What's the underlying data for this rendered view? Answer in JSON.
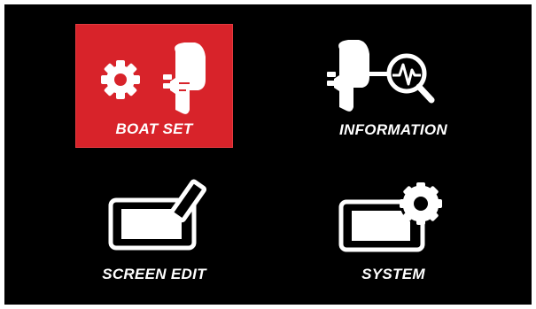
{
  "menu": {
    "items": [
      {
        "label": "BOAT SET",
        "icon": "gear-outboard-motor-icon",
        "selected": true
      },
      {
        "label": "INFORMATION",
        "icon": "outboard-motor-diagnostic-icon",
        "selected": false
      },
      {
        "label": "SCREEN EDIT",
        "icon": "screen-edit-pencil-icon",
        "selected": false
      },
      {
        "label": "SYSTEM",
        "icon": "screen-gear-icon",
        "selected": false
      }
    ]
  },
  "colors": {
    "background": "#000000",
    "selected_tile": "#d8232a",
    "foreground": "#ffffff"
  }
}
